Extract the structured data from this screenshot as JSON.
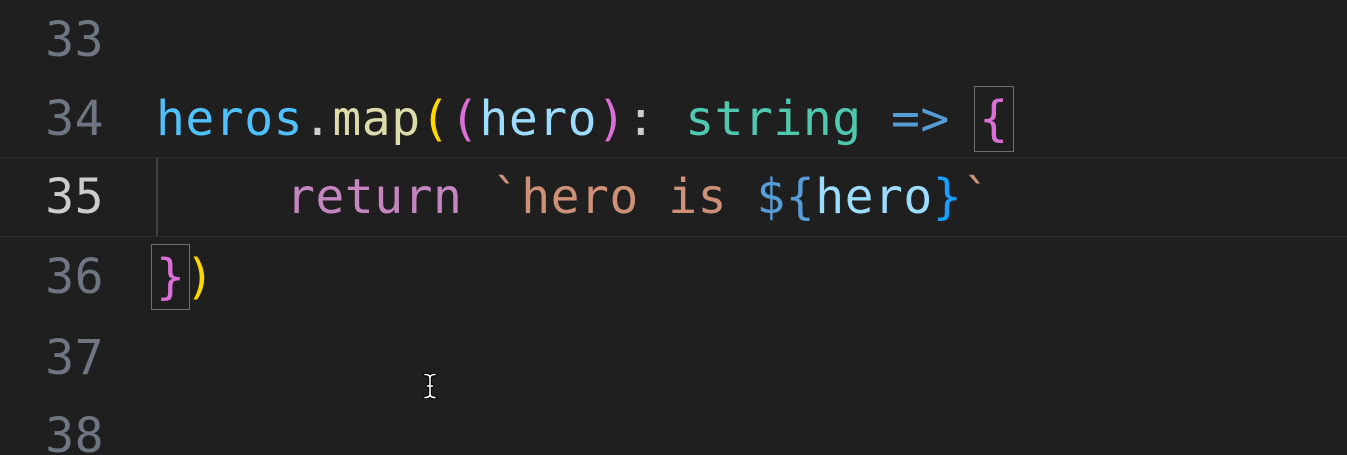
{
  "editor": {
    "lines": [
      {
        "number": "33",
        "active": false
      },
      {
        "number": "34",
        "active": false,
        "tokens": [
          "heros",
          ".",
          "map",
          "(",
          "(",
          "hero",
          ")",
          ":",
          "string",
          "=>",
          "{"
        ]
      },
      {
        "number": "35",
        "active": true,
        "tokens": [
          "return",
          "`hero is ",
          "${",
          "hero",
          "}",
          "`"
        ]
      },
      {
        "number": "36",
        "active": false,
        "tokens": [
          "}",
          ")"
        ]
      },
      {
        "number": "37",
        "active": false
      },
      {
        "number": "38",
        "active": false
      }
    ]
  },
  "colors": {
    "background": "#1f1f1f",
    "line_number": "#6e7681",
    "line_number_active": "#cccccc",
    "variable": "#9cdcfe",
    "function": "#dcdcaa",
    "type": "#4ec9b0",
    "keyword": "#c586c0",
    "string": "#ce9178",
    "bracket_level1": "#ffd700",
    "bracket_level2": "#da70d6",
    "bracket_level3": "#179fff"
  },
  "cursor": {
    "icon": "text-cursor-ibeam-icon"
  }
}
